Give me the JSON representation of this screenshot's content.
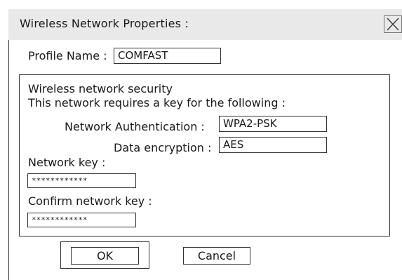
{
  "window": {
    "title": "Wireless Network Properties :",
    "close_icon": "close-x-icon"
  },
  "profile": {
    "label": "Profile Name :",
    "value": "COMFAST"
  },
  "security": {
    "heading": "Wireless network security",
    "subheading": "This network requires a key for the following :",
    "auth_label": "Network Authentication :",
    "auth_value": "WPA2-PSK",
    "enc_label": "Data encryption :",
    "enc_value": "AES",
    "key_label": "Network key :",
    "key_value": "************",
    "confirm_label": "Confirm network key :",
    "confirm_value": "************"
  },
  "buttons": {
    "ok": "OK",
    "cancel": "Cancel"
  }
}
